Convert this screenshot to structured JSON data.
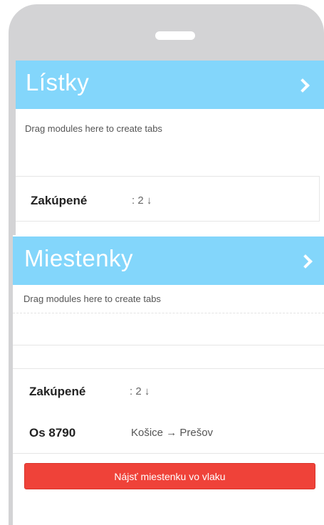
{
  "tickets": {
    "title": "Lístky",
    "drop_hint": "Drag modules here to create tabs",
    "purchased_label": "Zakúpené",
    "purchased_value": ": 2 ↓"
  },
  "seats": {
    "title": "Miestenky",
    "drop_hint": "Drag modules here to create tabs",
    "purchased_label": "Zakúpené",
    "purchased_value": ": 2 ↓",
    "train": {
      "number": "Os 8790",
      "route": "Košice → Prešov"
    },
    "find_button_label": "Nájsť miestenku vo vlaku"
  },
  "colors": {
    "header_blue": "#83d6fb",
    "button_red": "#ef4239",
    "frame_gray": "#d3d3d5"
  }
}
